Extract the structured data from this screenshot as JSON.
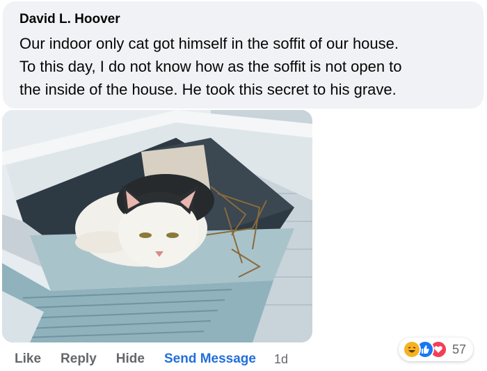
{
  "comment": {
    "author": "David L. Hoover",
    "text_lines": [
      "Our indoor only cat got himself in the soffit of our house.",
      "To this day, I do not know how as the soffit is not open to",
      "the inside of the house. He took this secret to his grave."
    ]
  },
  "photo": {
    "icon": "cat-in-soffit-photo"
  },
  "actions": {
    "like": "Like",
    "reply": "Reply",
    "hide": "Hide",
    "send_message": "Send Message",
    "time": "1d"
  },
  "reactions": {
    "types": [
      "haha",
      "like",
      "love"
    ],
    "count": "57",
    "colors": {
      "haha": "#f7b125",
      "like": "#1877f2",
      "love": "#f33e58"
    }
  },
  "colors": {
    "bubble": "#f0f2f5",
    "link": "#216fdb",
    "secondary_text": "#65676b"
  }
}
